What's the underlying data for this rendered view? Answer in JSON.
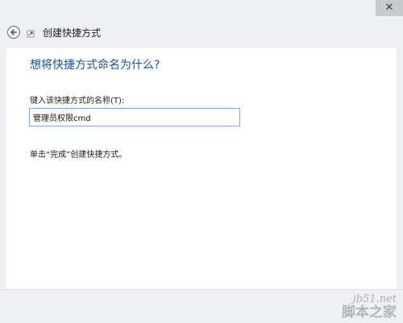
{
  "window": {
    "close_glyph": "✕"
  },
  "nav": {
    "title": "创建快捷方式"
  },
  "page": {
    "heading": "想将快捷方式命名为什么?",
    "field_label": "键入该快捷方式的名称(T):",
    "field_value": "管理员权限cmd",
    "hint": "单击“完成”创建快捷方式。"
  },
  "watermark": {
    "url": "jb51.net",
    "name": "脚本之家"
  },
  "colors": {
    "heading": "#1f4fa0",
    "input_border": "#7aa7d9",
    "chrome": "#eef0f3"
  }
}
